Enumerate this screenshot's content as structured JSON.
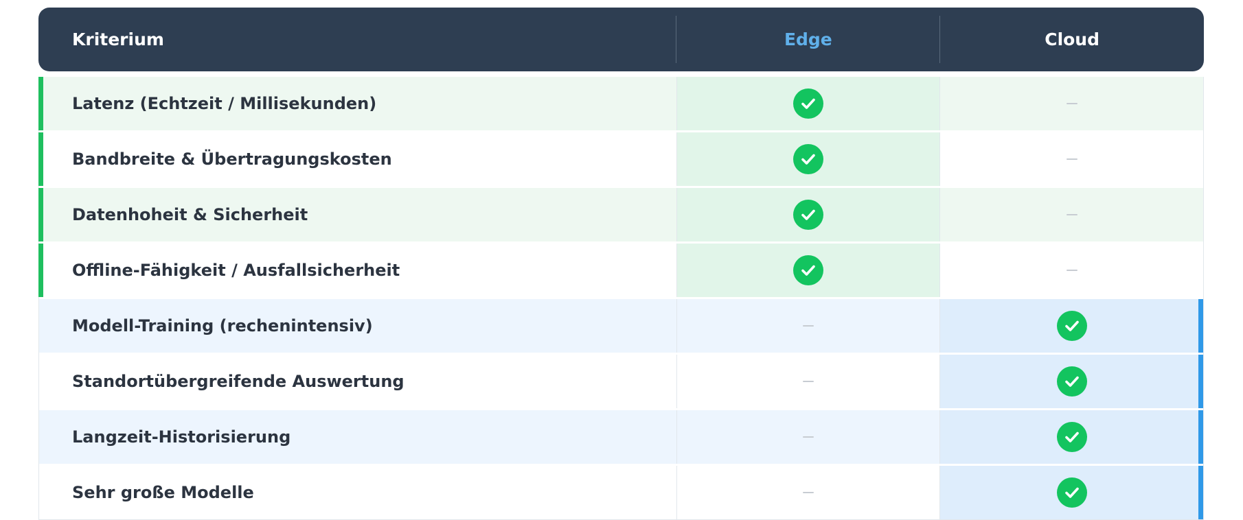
{
  "header": {
    "col_criterion": "Kriterium",
    "col_edge": "Edge",
    "col_cloud": "Cloud"
  },
  "colors": {
    "header_bg": "#2e3e52",
    "edge_accent": "#1fbf5f",
    "cloud_accent": "#2f99e8",
    "edge_title": "#60b0ea",
    "check": "#13c45f"
  },
  "rows": [
    {
      "label": "Latenz (Echtzeit / Millisekunden)",
      "winner": "edge"
    },
    {
      "label": "Bandbreite & Übertragungskosten",
      "winner": "edge"
    },
    {
      "label": "Datenhoheit & Sicherheit",
      "winner": "edge"
    },
    {
      "label": "Offline-Fähigkeit / Ausfallsicherheit",
      "winner": "edge"
    },
    {
      "label": "Modell-Training (rechenintensiv)",
      "winner": "cloud"
    },
    {
      "label": "Standortübergreifende Auswertung",
      "winner": "cloud"
    },
    {
      "label": "Langzeit-Historisierung",
      "winner": "cloud"
    },
    {
      "label": "Sehr große Modelle",
      "winner": "cloud"
    }
  ]
}
